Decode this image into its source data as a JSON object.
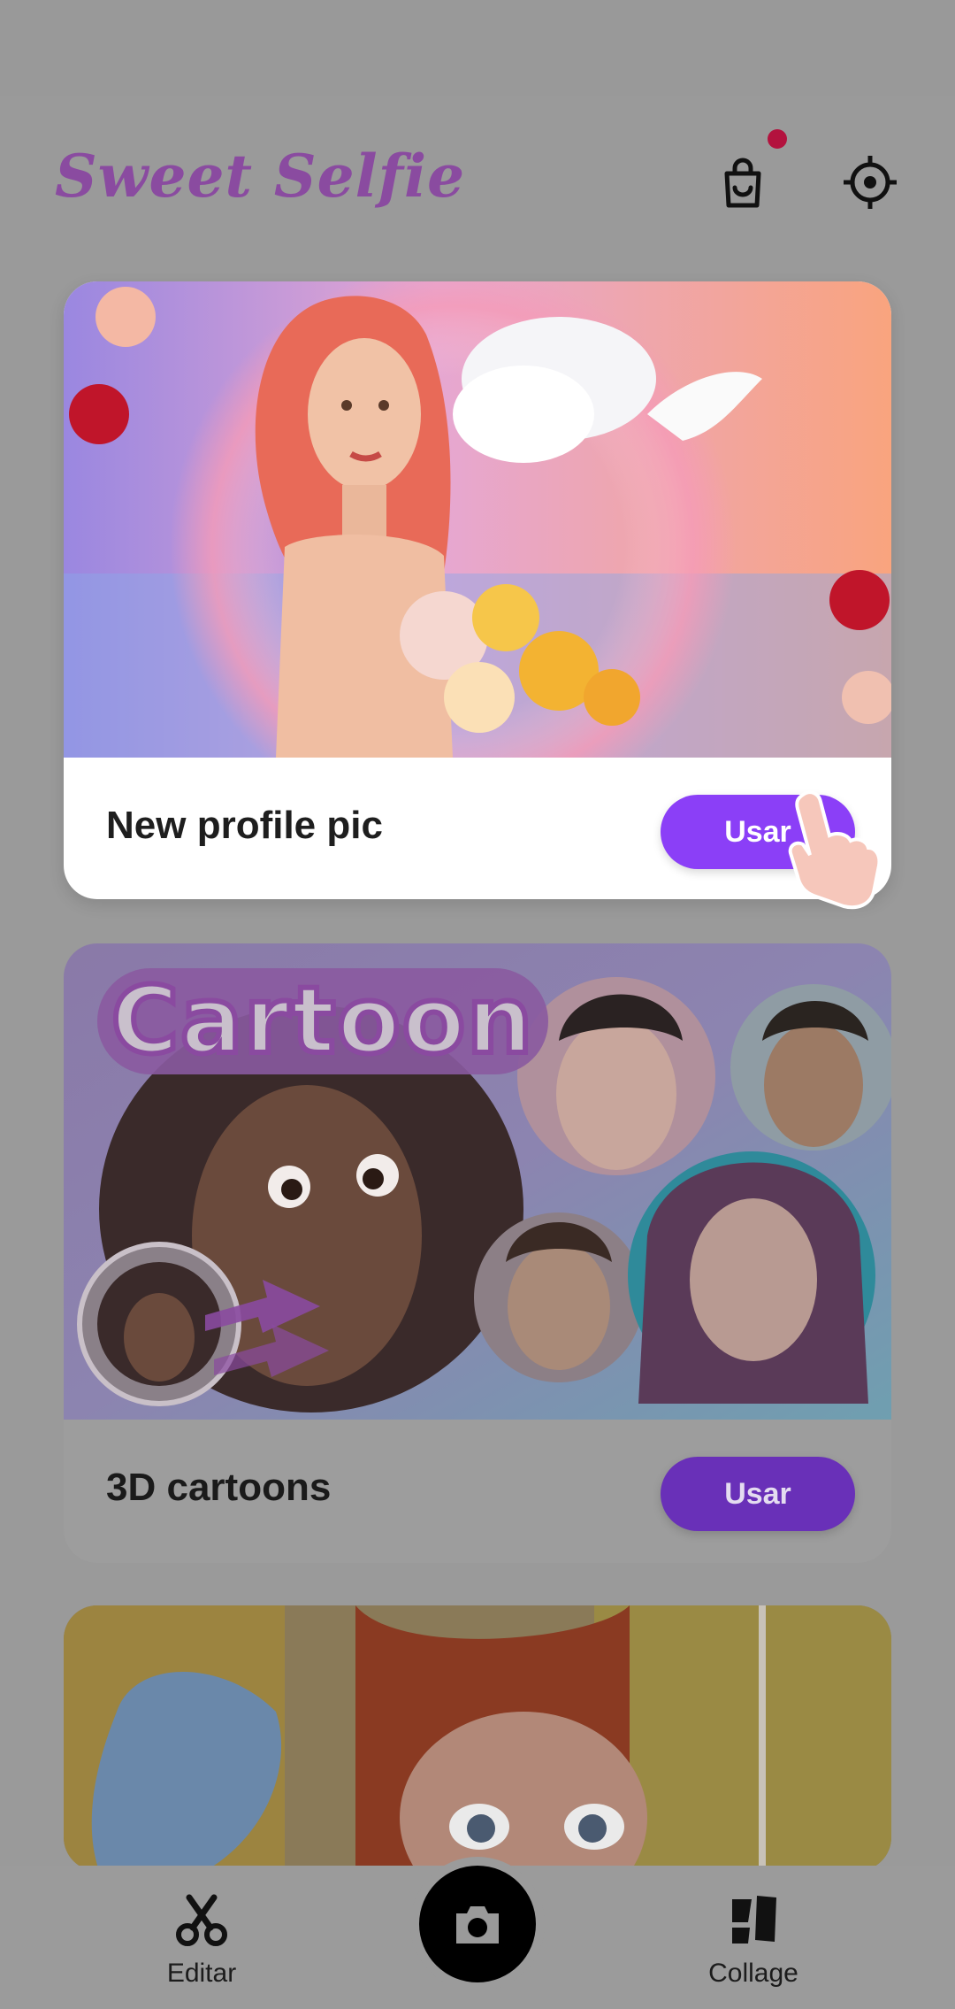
{
  "header": {
    "app_title": "Sweet Selfie",
    "icons": [
      "shopping-bag-icon",
      "settings-icon"
    ],
    "notification_dot_color": "#b3123e"
  },
  "cards": [
    {
      "label": "New profile pic",
      "button_label": "Usar",
      "image": "woman-with-flowers-artwork"
    },
    {
      "label": "3D cartoons",
      "button_label": "Usar",
      "image": "cartoon-portraits-collage",
      "image_text": "Cartoon"
    },
    {
      "label": "",
      "image": "cartoon-girl-partial"
    }
  ],
  "bottom_nav": {
    "edit_label": "Editar",
    "collage_label": "Collage",
    "icons": [
      "scissors-icon",
      "camera-icon",
      "collage-icon"
    ]
  },
  "colors": {
    "accent": "#8b3ff7",
    "title": "#8a4ba0"
  }
}
